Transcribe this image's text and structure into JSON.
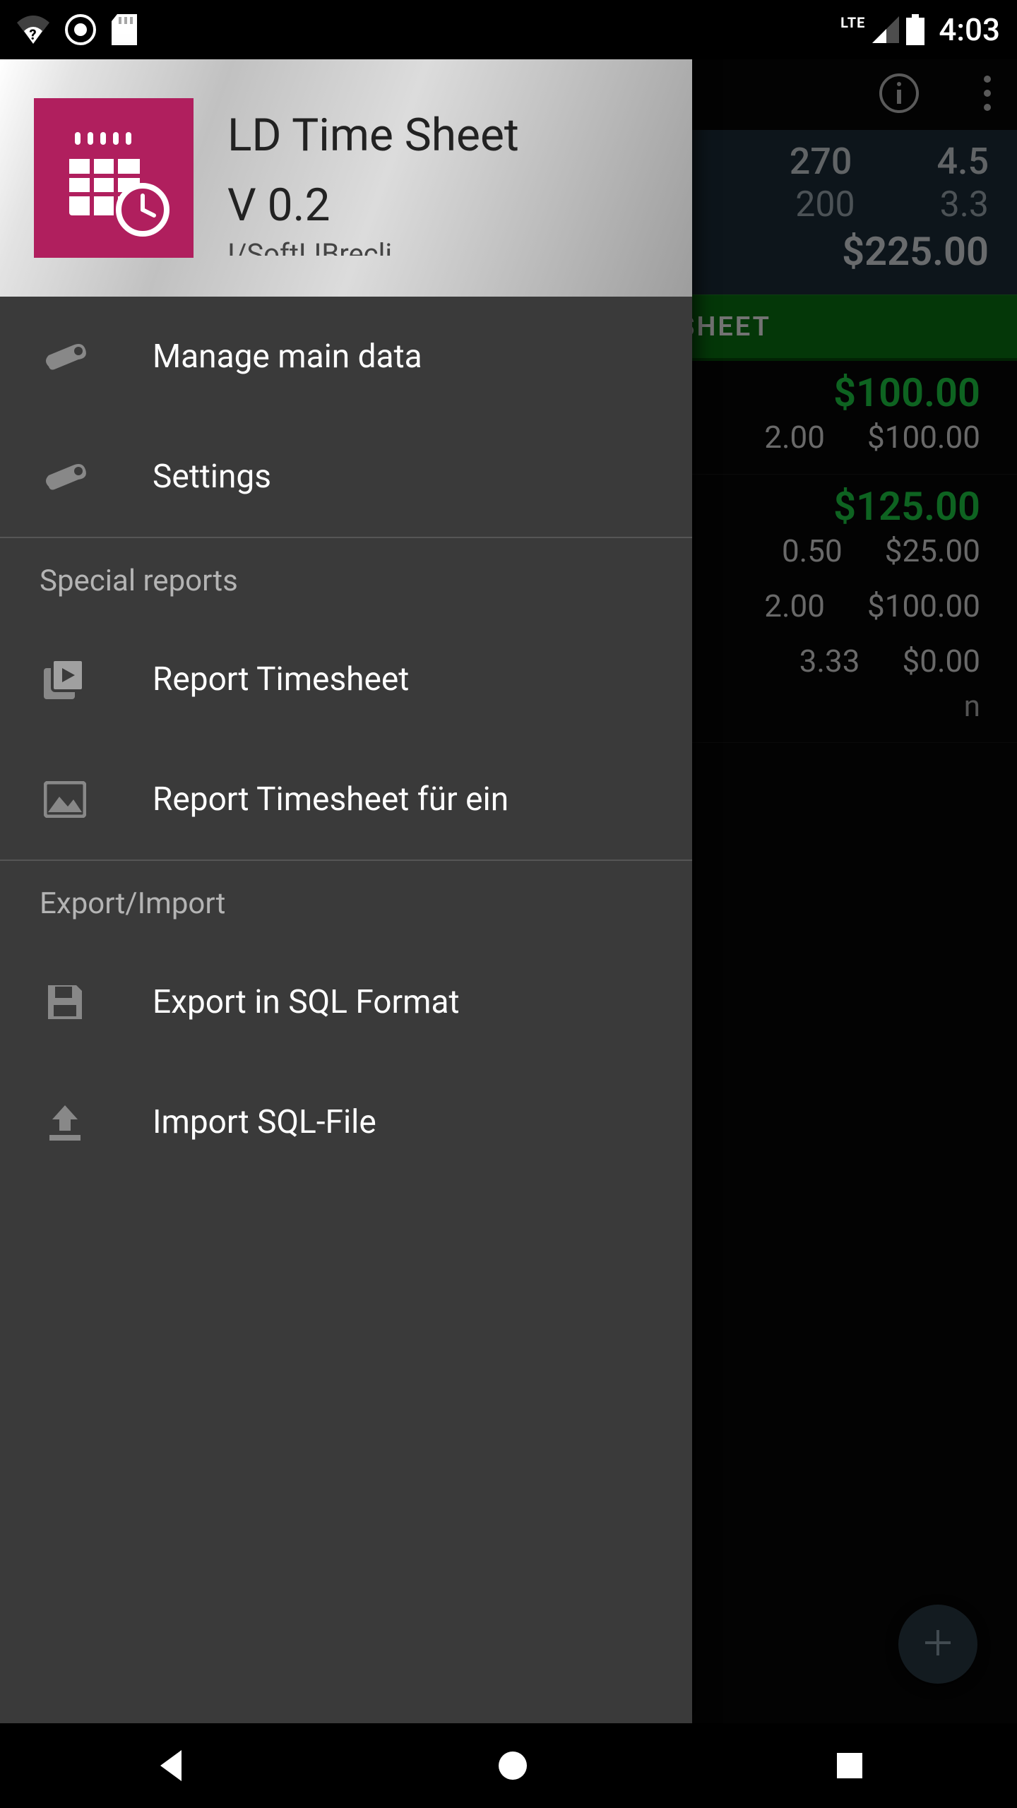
{
  "status": {
    "clock": "4:03",
    "lte": "LTE"
  },
  "drawer": {
    "app_name": "LD Time Sheet",
    "version": "V 0.2",
    "items": [
      {
        "label": "Manage main data",
        "icon": "wrench-icon"
      },
      {
        "label": "Settings",
        "icon": "wrench-icon"
      }
    ],
    "section_reports": "Special reports",
    "reports": [
      {
        "label": "Report Timesheet",
        "icon": "play-stack-icon"
      },
      {
        "label": "Report Timesheet für ein",
        "icon": "image-icon"
      }
    ],
    "section_export": "Export/Import",
    "export": [
      {
        "label": "Export in SQL Format",
        "icon": "save-icon"
      },
      {
        "label": "Import SQL-File",
        "icon": "upload-icon"
      }
    ]
  },
  "summary": {
    "row1": {
      "col1": "270",
      "col2": "4.5"
    },
    "row2": {
      "col1": "200",
      "col2": "3.3"
    },
    "total": "$225.00"
  },
  "day_sheet_label": "DAY SHEET",
  "entries": [
    {
      "amount": "$100.00",
      "lines": [
        {
          "qty": "2.00",
          "price": "$100.00"
        }
      ]
    },
    {
      "amount": "$125.00",
      "lines": [
        {
          "qty": "0.50",
          "price": "$25.00"
        },
        {
          "qty": "2.00",
          "price": "$100.00"
        },
        {
          "qty": "3.33",
          "price": "$0.00"
        }
      ]
    }
  ],
  "entry_tail": "n"
}
